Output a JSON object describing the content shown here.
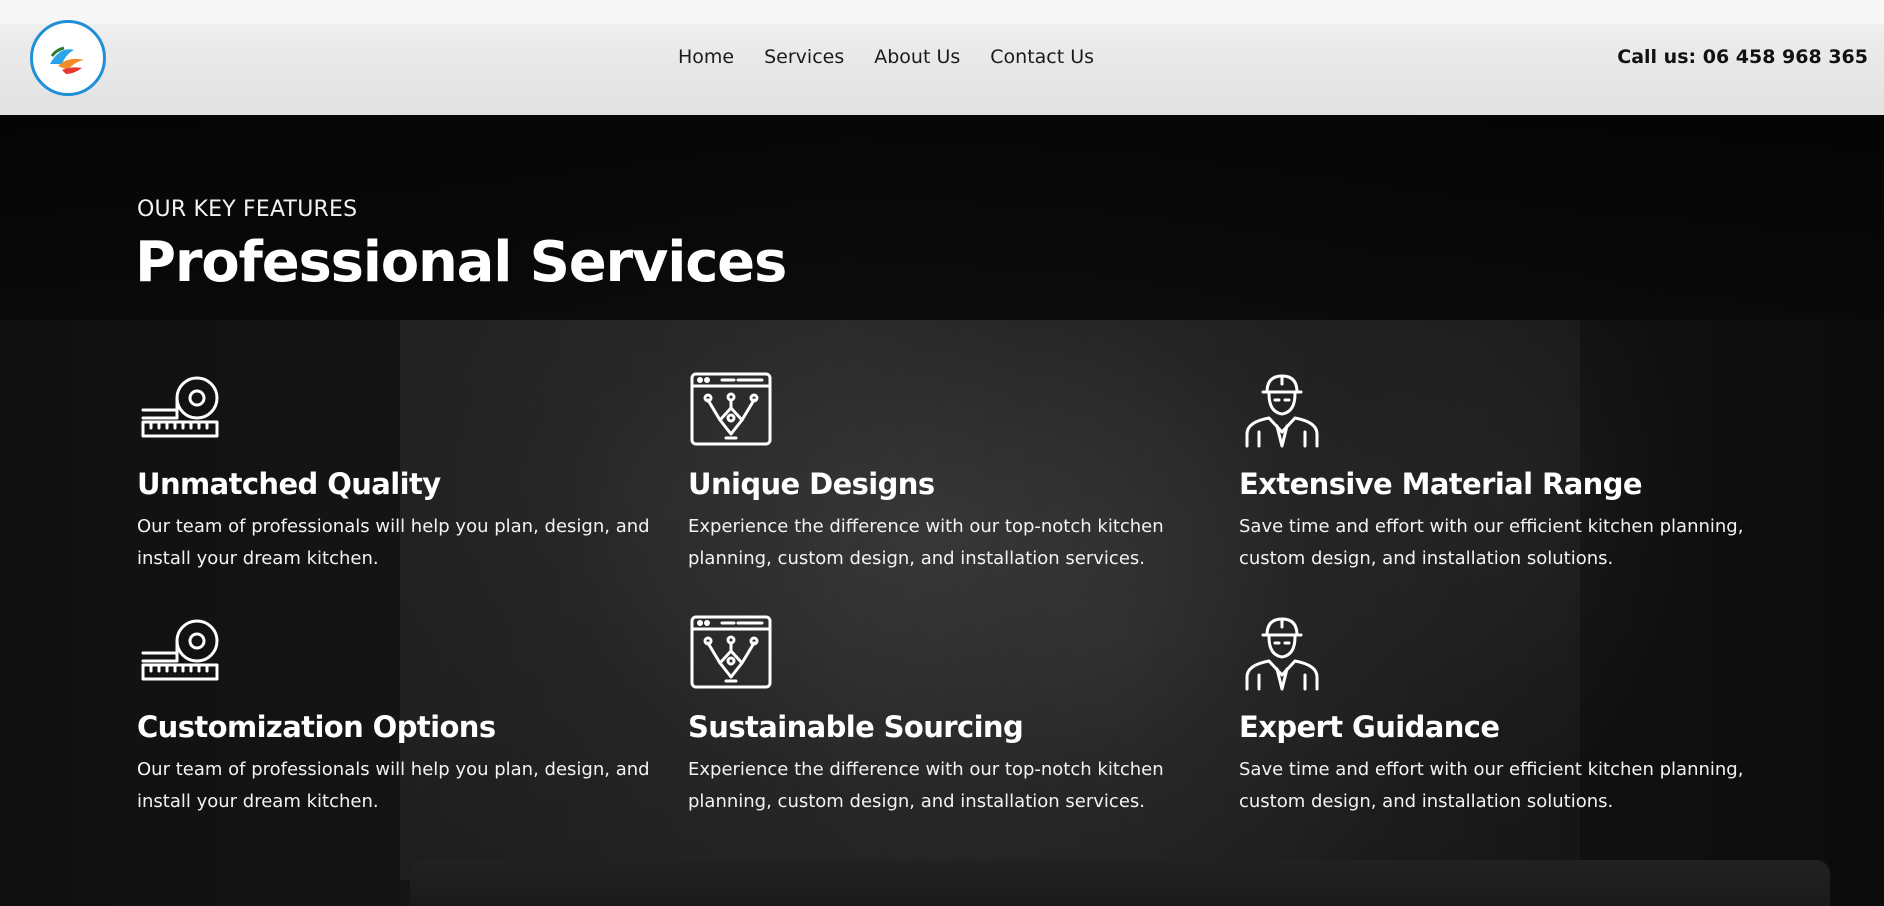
{
  "header": {
    "logo_icon": "company-logo",
    "nav": [
      "Home",
      "Services",
      "About Us",
      "Contact Us"
    ],
    "phone": "Call us: 06 458 968 365"
  },
  "hero": {
    "eyebrow": "OUR KEY FEATURES",
    "title_main": "Professional",
    "title_highlight": "Services",
    "highlight_color": "#e8ab62"
  },
  "features": [
    {
      "icon": "tape-measure-icon",
      "title": "Unmatched Quality",
      "text": "Our team of professionals will help you plan, design, and install your dream kitchen."
    },
    {
      "icon": "design-window-icon",
      "title": "Unique Designs",
      "text": "Experience the difference with our top-notch kitchen planning, custom design, and installation services."
    },
    {
      "icon": "worker-icon",
      "title": "Extensive Material Range",
      "text": "Save time and effort with our efficient kitchen planning, custom design, and installation solutions."
    },
    {
      "icon": "tape-measure-icon",
      "title": "Customization Options",
      "text": "Our team of professionals will help you plan, design, and install your dream kitchen."
    },
    {
      "icon": "design-window-icon",
      "title": "Sustainable Sourcing",
      "text": "Experience the difference with our top-notch kitchen planning, custom design, and installation services."
    },
    {
      "icon": "worker-icon",
      "title": "Expert Guidance",
      "text": "Save time and effort with our efficient kitchen planning, custom design, and installation solutions."
    }
  ]
}
